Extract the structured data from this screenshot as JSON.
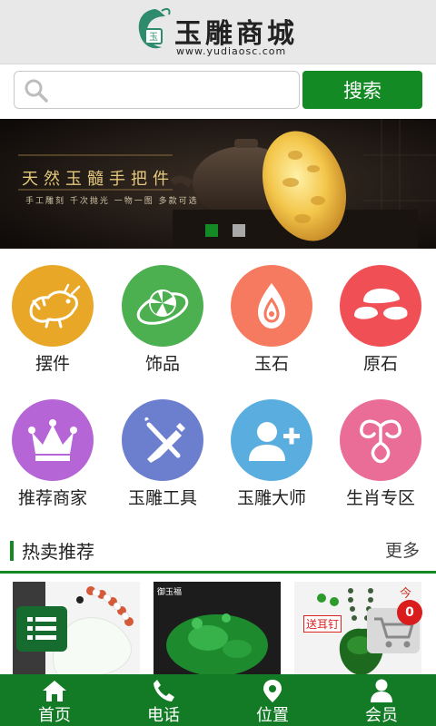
{
  "header": {
    "logo_title": "玉雕商城",
    "logo_url": "www.yudiaosc.com"
  },
  "search": {
    "placeholder": "",
    "button_label": "搜索"
  },
  "banner": {
    "title": "天然玉髓手把件",
    "subtitle": "手工雕刻 千次抛光 一物一图 多款可选",
    "active_slide": 1,
    "slide_count": 2
  },
  "categories": [
    {
      "label": "摆件",
      "icon": "dragon-icon",
      "color": "#e9a727"
    },
    {
      "label": "饰品",
      "icon": "pendant-icon",
      "color": "#4caf50"
    },
    {
      "label": "玉石",
      "icon": "jade-stone-icon",
      "color": "#f67a5f"
    },
    {
      "label": "原石",
      "icon": "raw-stone-icon",
      "color": "#ef4f55"
    },
    {
      "label": "推荐商家",
      "icon": "crown-icon",
      "color": "#b565d6"
    },
    {
      "label": "玉雕工具",
      "icon": "tools-icon",
      "color": "#6c7fce"
    },
    {
      "label": "玉雕大师",
      "icon": "add-user-icon",
      "color": "#5aaedf"
    },
    {
      "label": "生肖专区",
      "icon": "zodiac-icon",
      "color": "#ea6d98"
    }
  ],
  "section": {
    "title": "热卖推荐",
    "more": "更多"
  },
  "products": [
    {
      "caption": ""
    },
    {
      "caption": "御玉福"
    },
    {
      "caption": "送耳钉"
    }
  ],
  "cart": {
    "count": "0",
    "tag": "今"
  },
  "bottom_nav": [
    {
      "label": "首页",
      "icon": "home-icon"
    },
    {
      "label": "电话",
      "icon": "phone-icon"
    },
    {
      "label": "位置",
      "icon": "location-pin-icon"
    },
    {
      "label": "会员",
      "icon": "member-icon"
    }
  ],
  "colors": {
    "brand_green": "#138a23",
    "nav_green": "#137a26"
  }
}
